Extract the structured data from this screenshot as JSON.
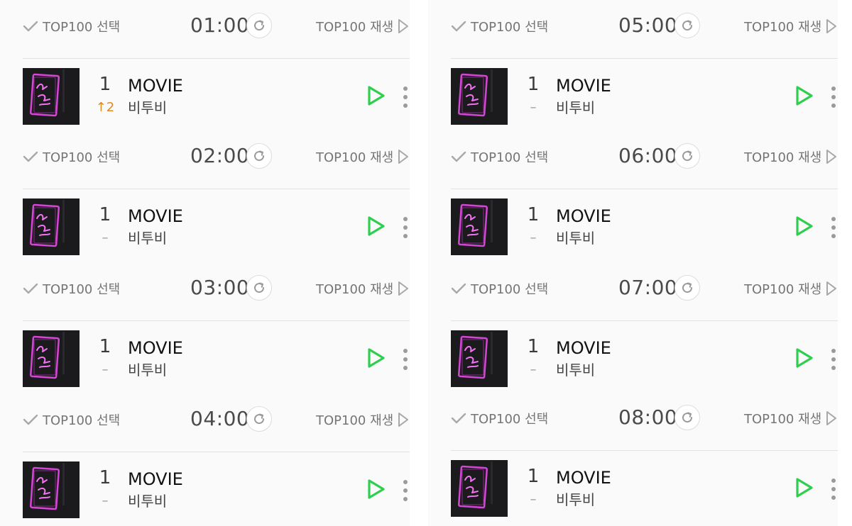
{
  "colors": {
    "accent_play": "#2fce4f",
    "rank_up": "#e08a1e",
    "muted": "#757575"
  },
  "icons": {
    "check": "check-icon",
    "refresh": "refresh-icon",
    "play_all": "play-outline-icon",
    "play": "play-icon",
    "more": "more-vertical-icon"
  },
  "columns": [
    {
      "blocks": [
        {
          "select_label": "TOP100 선택",
          "time": "01:00",
          "play_all_label": "TOP100 재생",
          "song": {
            "rank": "1",
            "change": "↑2",
            "change_dir": "up",
            "title": "MOVIE",
            "artist": "비투비"
          }
        },
        {
          "select_label": "TOP100 선택",
          "time": "02:00",
          "play_all_label": "TOP100 재생",
          "song": {
            "rank": "1",
            "change": "–",
            "change_dir": "same",
            "title": "MOVIE",
            "artist": "비투비"
          }
        },
        {
          "select_label": "TOP100 선택",
          "time": "03:00",
          "play_all_label": "TOP100 재생",
          "song": {
            "rank": "1",
            "change": "–",
            "change_dir": "same",
            "title": "MOVIE",
            "artist": "비투비"
          }
        },
        {
          "select_label": "TOP100 선택",
          "time": "04:00",
          "play_all_label": "TOP100 재생",
          "song": {
            "rank": "1",
            "change": "–",
            "change_dir": "same",
            "title": "MOVIE",
            "artist": "비투비"
          }
        }
      ]
    },
    {
      "blocks": [
        {
          "select_label": "TOP100 선택",
          "time": "05:00",
          "play_all_label": "TOP100 재생",
          "song": {
            "rank": "1",
            "change": "–",
            "change_dir": "same",
            "title": "MOVIE",
            "artist": "비투비"
          }
        },
        {
          "select_label": "TOP100 선택",
          "time": "06:00",
          "play_all_label": "TOP100 재생",
          "song": {
            "rank": "1",
            "change": "–",
            "change_dir": "same",
            "title": "MOVIE",
            "artist": "비투비"
          }
        },
        {
          "select_label": "TOP100 선택",
          "time": "07:00",
          "play_all_label": "TOP100 재생",
          "song": {
            "rank": "1",
            "change": "–",
            "change_dir": "same",
            "title": "MOVIE",
            "artist": "비투비"
          }
        },
        {
          "select_label": "TOP100 선택",
          "time": "08:00",
          "play_all_label": "TOP100 재생",
          "song": {
            "rank": "1",
            "change": "–",
            "change_dir": "same",
            "title": "MOVIE",
            "artist": "비투비"
          }
        }
      ]
    }
  ]
}
